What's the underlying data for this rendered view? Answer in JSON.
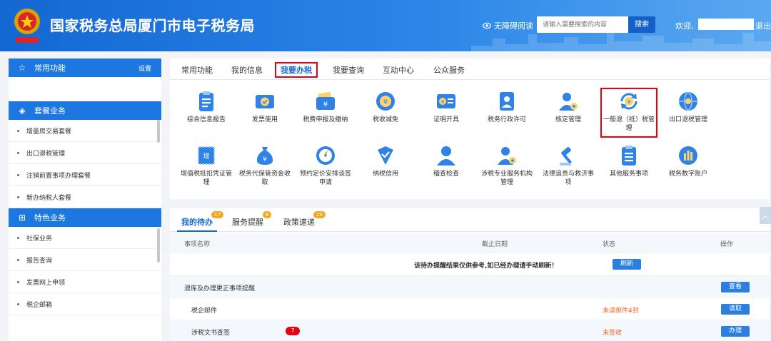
{
  "header": {
    "title": "国家税务总局厦门市电子税务局",
    "accessibility": "无障碍阅读",
    "search_placeholder": "请输入需要搜索的内容",
    "search_button": "搜索",
    "welcome": "欢迎,",
    "logout": "退出",
    "colors": {
      "primary": "#1467d2",
      "highlight": "#e60012"
    }
  },
  "sidebar": {
    "common": {
      "title": "常用功能",
      "settings": "设置"
    },
    "package": {
      "title": "套餐业务",
      "items": [
        "增量房交易套餐",
        "出口退税管理",
        "注销前置事项办理套餐",
        "新办纳税人套餐"
      ]
    },
    "special": {
      "title": "特色业务",
      "items": [
        "社保业务",
        "报告查询",
        "发票网上申领",
        "税企邮箱"
      ]
    }
  },
  "tabs": [
    "常用功能",
    "我的信息",
    "我要办税",
    "我要查询",
    "互动中心",
    "公众服务"
  ],
  "active_tab": "我要办税",
  "functions": [
    {
      "label": "综合信息报告",
      "icon": "clipboard-icon"
    },
    {
      "label": "发票使用",
      "icon": "invoice-icon"
    },
    {
      "label": "税费申报及缴纳",
      "icon": "wallet-icon"
    },
    {
      "label": "税收减免",
      "icon": "tax-reduction-icon"
    },
    {
      "label": "证明开具",
      "icon": "certificate-icon"
    },
    {
      "label": "税务行政许可",
      "icon": "id-card-icon"
    },
    {
      "label": "核定管理",
      "icon": "user-gear-icon"
    },
    {
      "label": "一般退（抵）税管理",
      "icon": "refund-icon"
    },
    {
      "label": "出口退税管理",
      "icon": "globe-icon"
    },
    {
      "label": "增值税抵扣凭证管理",
      "icon": "voucher-icon"
    },
    {
      "label": "税务代保管资金收取",
      "icon": "money-bag-icon"
    },
    {
      "label": "预约定价安排谈签申请",
      "icon": "compass-icon"
    },
    {
      "label": "纳税信用",
      "icon": "credit-shield-icon"
    },
    {
      "label": "稽查检查",
      "icon": "inspector-icon"
    },
    {
      "label": "涉税专业服务机构管理",
      "icon": "agency-icon"
    },
    {
      "label": "法律追责与救济事项",
      "icon": "gavel-icon"
    },
    {
      "label": "其他服务事项",
      "icon": "list-icon"
    },
    {
      "label": "税务数字账户",
      "icon": "digital-account-icon"
    }
  ],
  "todo": {
    "tabs": [
      {
        "label": "我的待办",
        "count": "17"
      },
      {
        "label": "服务提醒",
        "count": "6"
      },
      {
        "label": "政策速递",
        "count": "25"
      }
    ],
    "columns": {
      "name": "事项名称",
      "deadline": "截止日期",
      "status": "状态",
      "action": "操作"
    },
    "notice": "该待办提醒结果仅供参考,如已经办理请手动刷新！",
    "refresh": "刷新",
    "rows": [
      {
        "name": "退库及办理更正事项提醒",
        "status": "",
        "action": "查看",
        "badge": ""
      },
      {
        "name": "税企邮件",
        "status": "未读邮件4封",
        "action": "读取",
        "badge": ""
      },
      {
        "name": "涉税文书查签",
        "status": "未签收",
        "action": "办理",
        "badge": "7"
      }
    ]
  }
}
